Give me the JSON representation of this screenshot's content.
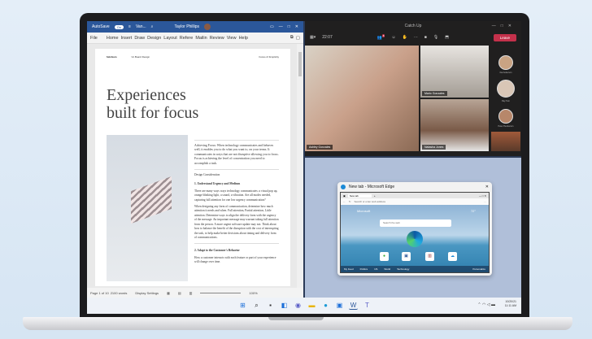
{
  "word": {
    "autosave": "AutoSave",
    "toggle": "On",
    "filename": "Van...",
    "user": "Taylor Phillips",
    "ribbon": [
      "File",
      "Home",
      "Insert",
      "Draw",
      "Design",
      "Layout",
      "Refere",
      "Mailin",
      "Review",
      "View",
      "Help"
    ],
    "doc": {
      "brand": "fabrikam",
      "header_mid": "Vs Board Design",
      "header_right": "Focus & Simplicity",
      "title_line1": "Experiences",
      "title_line2": "built for focus",
      "intro": "Achieving Focus: When technology communicates and behaves well, it enables you to do what you want to, on your terms. It communicates in ways that are not disruptive allowing you to focus. Focus is achieving the level of concentration you need to accomplish a task.",
      "section": "Design Consideration",
      "h1": "1. Understand Urgency and Medium",
      "p1": "There are many ways ways technology communicates: a visual pop up, orange blinking light, a sound, a vibration. Are all modes needed, capturing full attention for one low urgency communication?",
      "p2": "When designing any form of communication, determine how much attention it needs and when. Full attention, Partial attention, Little attention. Determine ways to align the delivery form with the urgency of the message. An important message may warrant taking full attention from the person. A more urgent software update may not. Think about how to balance the benefit of the disruption with the cost of interrupting the task, to help make better decisions about timing and delivery form of communications.",
      "h2": "2. Adapt to the Customer's Behavior",
      "p3": "How a customer interacts with each feature or part of your experience will change over time."
    },
    "status": {
      "page": "Page 1 of 10",
      "words": "2100 words",
      "display": "Display Settings",
      "zoom": "100%"
    }
  },
  "teams": {
    "title": "Catch Up",
    "timer": "22:07",
    "leave": "Leave",
    "badge": "8",
    "tiles": [
      "Ashley Gonzales",
      "Mario Gonzales",
      "Natasha Jones"
    ],
    "roster": [
      "Kai Anderson",
      "Ray Tam",
      "Peter Henderson"
    ]
  },
  "edge": {
    "window_title": "New tab - Microsoft Edge",
    "tab": "New tab",
    "address": "Search or enter web address",
    "brand": "Microsoft",
    "search": "Search the web",
    "weather": "72°",
    "nav": [
      "My Feed",
      "Politics",
      "US",
      "World",
      "Technology"
    ],
    "personalize": "Personalize"
  },
  "taskbar": {
    "date": "10/20/21",
    "time": "11:11 AM"
  }
}
